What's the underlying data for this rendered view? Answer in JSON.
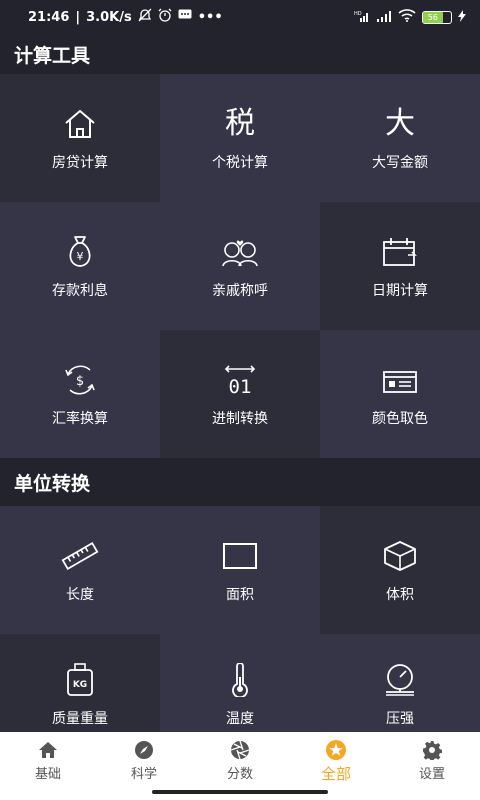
{
  "status_bar": {
    "time": "21:46",
    "speed": "3.0K/s",
    "battery": "56"
  },
  "sections": [
    {
      "title": "计算工具",
      "items": [
        {
          "label": "房贷计算",
          "icon": "house-icon"
        },
        {
          "label": "个税计算",
          "icon": "tax-char-icon",
          "char": "税"
        },
        {
          "label": "大写金额",
          "icon": "big-char-icon",
          "char": "大"
        },
        {
          "label": "存款利息",
          "icon": "money-bag-icon"
        },
        {
          "label": "亲戚称呼",
          "icon": "couple-icon"
        },
        {
          "label": "日期计算",
          "icon": "calendar-icon"
        },
        {
          "label": "汇率换算",
          "icon": "exchange-icon"
        },
        {
          "label": "进制转换",
          "icon": "binary-icon",
          "char": "01"
        },
        {
          "label": "颜色取色",
          "icon": "color-card-icon"
        }
      ]
    },
    {
      "title": "单位转换",
      "items": [
        {
          "label": "长度",
          "icon": "ruler-icon"
        },
        {
          "label": "面积",
          "icon": "square-icon"
        },
        {
          "label": "体积",
          "icon": "cube-icon"
        },
        {
          "label": "质量重量",
          "icon": "weight-icon",
          "char": "KG"
        },
        {
          "label": "温度",
          "icon": "thermometer-icon"
        },
        {
          "label": "压强",
          "icon": "gauge-icon"
        }
      ]
    }
  ],
  "tabbar": {
    "tabs": [
      {
        "label": "基础",
        "icon": "home-icon"
      },
      {
        "label": "科学",
        "icon": "compass-icon"
      },
      {
        "label": "分数",
        "icon": "aperture-icon"
      },
      {
        "label": "全部",
        "icon": "star-icon"
      },
      {
        "label": "设置",
        "icon": "gear-icon"
      }
    ],
    "active_index": 3,
    "active_color": "#f5a623"
  }
}
